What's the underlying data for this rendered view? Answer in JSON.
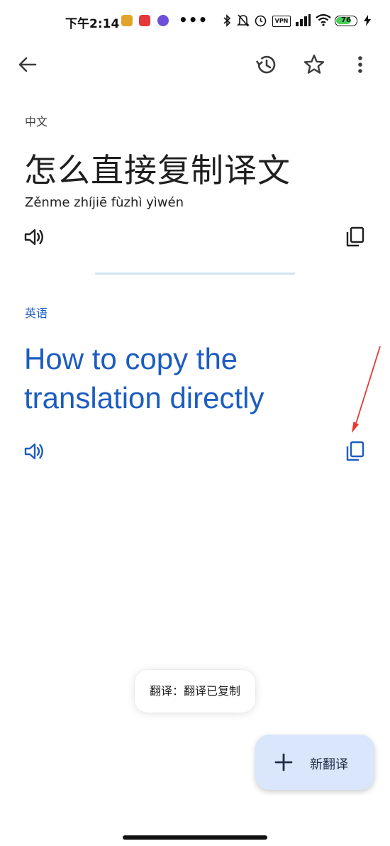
{
  "status_bar": {
    "time": "下午2:14",
    "dots": "•••",
    "vpn": "VPN",
    "battery_level": "76",
    "battery_fraction": 0.76
  },
  "toolbar": {
    "back_icon": "arrow-back-icon",
    "history_icon": "history-icon",
    "star_icon": "star-icon",
    "more_icon": "more-vert-icon"
  },
  "source": {
    "language": "中文",
    "text": "怎么直接复制译文",
    "pinyin": "Zěnme zhíjiē fùzhì yìwén"
  },
  "target": {
    "language": "英语",
    "text": "How to copy the translation directly"
  },
  "toast": {
    "message": "翻译：翻译已复制"
  },
  "fab": {
    "label": "新翻译"
  },
  "colors": {
    "accent_blue": "#1c5dbf",
    "divider": "#cfe3f1",
    "fab_bg": "#d9e6fb",
    "annotation_red": "#e53935"
  }
}
